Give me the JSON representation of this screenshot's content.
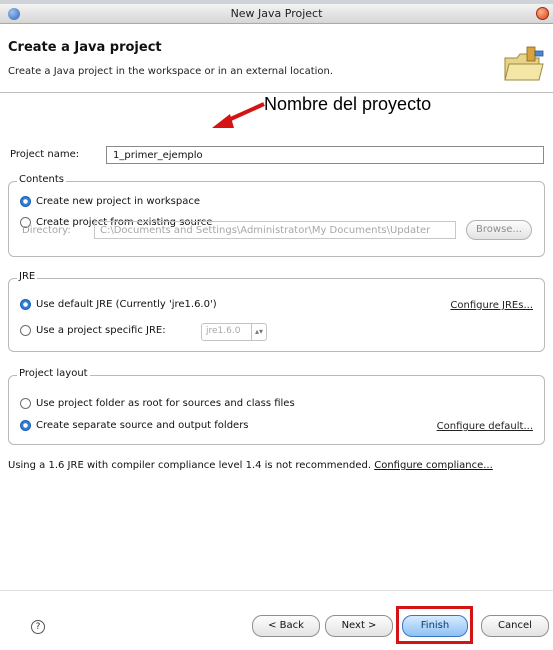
{
  "window": {
    "title": "New Java Project"
  },
  "header": {
    "title": "Create a Java project",
    "description": "Create a Java project in the workspace or in an external location.",
    "icon": "folder-wizard-icon"
  },
  "annotation": {
    "text": "Nombre del proyecto",
    "color": "#d41414"
  },
  "project_name": {
    "label": "Project name:",
    "value": "1_primer_ejemplo"
  },
  "contents": {
    "title": "Contents",
    "options": [
      {
        "label": "Create new project in workspace",
        "selected": true
      },
      {
        "label": "Create project from existing source",
        "selected": false
      }
    ],
    "directory_label": "Directory:",
    "directory_value": "C:\\Documents and Settings\\Administrator\\My Documents\\Updater",
    "browse_label": "Browse..."
  },
  "jre": {
    "title": "JRE",
    "options": [
      {
        "label": "Use default JRE (Currently 'jre1.6.0')",
        "selected": true
      },
      {
        "label": "Use a project specific JRE:",
        "selected": false
      }
    ],
    "specific_value": "jre1.6.0",
    "configure_link": "Configure JREs..."
  },
  "layout": {
    "title": "Project layout",
    "options": [
      {
        "label": "Use project folder as root for sources and class files",
        "selected": false
      },
      {
        "label": "Create separate source and output folders",
        "selected": true
      }
    ],
    "configure_link": "Configure default..."
  },
  "warning": {
    "text": "Using a 1.6 JRE with compiler compliance level 1.4 is not recommended.",
    "link": "Configure compliance..."
  },
  "buttons": {
    "help": "?",
    "back": "< Back",
    "next": "Next >",
    "finish": "Finish",
    "cancel": "Cancel"
  }
}
